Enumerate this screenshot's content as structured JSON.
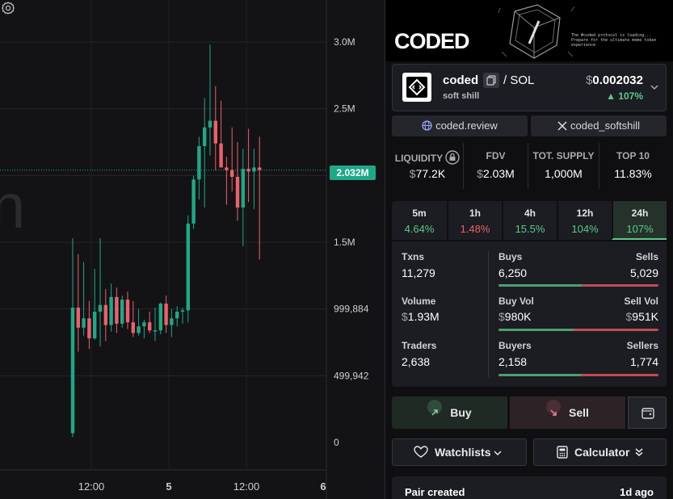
{
  "chart": {
    "y_labels": [
      "3.0M",
      "2.5M",
      "1.5M",
      "999,884",
      "499,942",
      "0"
    ],
    "x_labels": [
      "12:00",
      "5",
      "12:00",
      "6"
    ],
    "current_price_tag": "2.032M",
    "partial_overlay_glyph": "n",
    "candles": [
      {
        "o": 70000,
        "h": 1530000,
        "l": 40000,
        "c": 1010000
      },
      {
        "o": 1010000,
        "h": 1410000,
        "l": 680000,
        "c": 860000
      },
      {
        "o": 860000,
        "h": 1350000,
        "l": 800000,
        "c": 930000
      },
      {
        "o": 930000,
        "h": 1060000,
        "l": 700000,
        "c": 780000
      },
      {
        "o": 780000,
        "h": 1300000,
        "l": 770000,
        "c": 980000
      },
      {
        "o": 980000,
        "h": 1530000,
        "l": 720000,
        "c": 1030000
      },
      {
        "o": 1030000,
        "h": 1150000,
        "l": 760000,
        "c": 880000
      },
      {
        "o": 880000,
        "h": 1190000,
        "l": 830000,
        "c": 1090000
      },
      {
        "o": 1090000,
        "h": 1160000,
        "l": 820000,
        "c": 890000
      },
      {
        "o": 890000,
        "h": 1100000,
        "l": 860000,
        "c": 1070000
      },
      {
        "o": 1070000,
        "h": 1130000,
        "l": 850000,
        "c": 900000
      },
      {
        "o": 900000,
        "h": 1060000,
        "l": 790000,
        "c": 820000
      },
      {
        "o": 820000,
        "h": 1000000,
        "l": 800000,
        "c": 870000
      },
      {
        "o": 870000,
        "h": 920000,
        "l": 780000,
        "c": 900000
      },
      {
        "o": 900000,
        "h": 980000,
        "l": 820000,
        "c": 840000
      },
      {
        "o": 840000,
        "h": 1010000,
        "l": 760000,
        "c": 840000
      },
      {
        "o": 840000,
        "h": 1050000,
        "l": 810000,
        "c": 1040000
      },
      {
        "o": 1040000,
        "h": 1100000,
        "l": 820000,
        "c": 880000
      },
      {
        "o": 880000,
        "h": 1000000,
        "l": 790000,
        "c": 930000
      },
      {
        "o": 930000,
        "h": 1020000,
        "l": 870000,
        "c": 980000
      },
      {
        "o": 980000,
        "h": 1010000,
        "l": 890000,
        "c": 990000
      },
      {
        "o": 990000,
        "h": 1700000,
        "l": 900000,
        "c": 1640000
      },
      {
        "o": 1640000,
        "h": 2000000,
        "l": 1600000,
        "c": 1970000
      },
      {
        "o": 1970000,
        "h": 2290000,
        "l": 1820000,
        "c": 2220000
      },
      {
        "o": 2220000,
        "h": 2580000,
        "l": 1760000,
        "c": 2360000
      },
      {
        "o": 2360000,
        "h": 2980000,
        "l": 2150000,
        "c": 2410000
      },
      {
        "o": 2410000,
        "h": 2670000,
        "l": 2040000,
        "c": 2240000
      },
      {
        "o": 2240000,
        "h": 2560000,
        "l": 2080000,
        "c": 2060000
      },
      {
        "o": 2060000,
        "h": 2140000,
        "l": 1780000,
        "c": 2040000
      },
      {
        "o": 2040000,
        "h": 2360000,
        "l": 1880000,
        "c": 1990000
      },
      {
        "o": 1990000,
        "h": 2250000,
        "l": 1660000,
        "c": 1760000
      },
      {
        "o": 1760000,
        "h": 2200000,
        "l": 1470000,
        "c": 2050000
      },
      {
        "o": 2050000,
        "h": 2350000,
        "l": 1800000,
        "c": 2030000
      },
      {
        "o": 2030000,
        "h": 2200000,
        "l": 1750000,
        "c": 2060000
      },
      {
        "o": 2060000,
        "h": 2290000,
        "l": 1370000,
        "c": 2040000
      }
    ],
    "colors": {
      "up": "#1ea986",
      "down": "#ef5f6a"
    }
  },
  "banner": {
    "logo": "CODED",
    "tagline": "The #coded protocol is loading... Prepare for the ultimate meme token experience"
  },
  "token": {
    "name": "coded",
    "pair": "/ SOL",
    "subtitle": "soft shill",
    "price_symbol": "$",
    "price": "0.002032",
    "change": "▲ 107%"
  },
  "links": {
    "website": "coded.review",
    "twitter": "coded_softshill"
  },
  "stats": [
    {
      "label": "LIQUIDITY",
      "symbol": "$",
      "value": "77.2K"
    },
    {
      "label": "FDV",
      "symbol": "$",
      "value": "2.03M"
    },
    {
      "label": "TOT. SUPPLY",
      "symbol": "",
      "value": "1,000M"
    },
    {
      "label": "TOP 10",
      "symbol": "",
      "value": "11.83%"
    }
  ],
  "timeframes": [
    {
      "label": "5m",
      "value": "4.64%",
      "dir": "pos"
    },
    {
      "label": "1h",
      "value": "1.48%",
      "dir": "neg"
    },
    {
      "label": "4h",
      "value": "15.5%",
      "dir": "pos"
    },
    {
      "label": "12h",
      "value": "104%",
      "dir": "pos"
    },
    {
      "label": "24h",
      "value": "107%",
      "dir": "pos"
    }
  ],
  "txns": {
    "txns_label": "Txns",
    "txns_value": "11,279",
    "buys_label": "Buys",
    "buys_value": "6,250",
    "sells_label": "Sells",
    "sells_value": "5,029",
    "buys_share": 0.554,
    "volume_label": "Volume",
    "volume_symbol": "$",
    "volume_value": "1.93M",
    "buyvol_label": "Buy Vol",
    "buyvol_symbol": "$",
    "buyvol_value": "980K",
    "sellvol_label": "Sell Vol",
    "sellvol_symbol": "$",
    "sellvol_value": "951K",
    "buyvol_share": 0.507,
    "traders_label": "Traders",
    "traders_value": "2,638",
    "buyers_label": "Buyers",
    "buyers_value": "2,158",
    "sellers_label": "Sellers",
    "sellers_value": "1,774",
    "buyers_share": 0.549
  },
  "actions": {
    "buy": "Buy",
    "sell": "Sell",
    "watchlists": "Watchlists",
    "calculator": "Calculator"
  },
  "pair_info": {
    "label": "Pair created",
    "value": "1d ago"
  }
}
